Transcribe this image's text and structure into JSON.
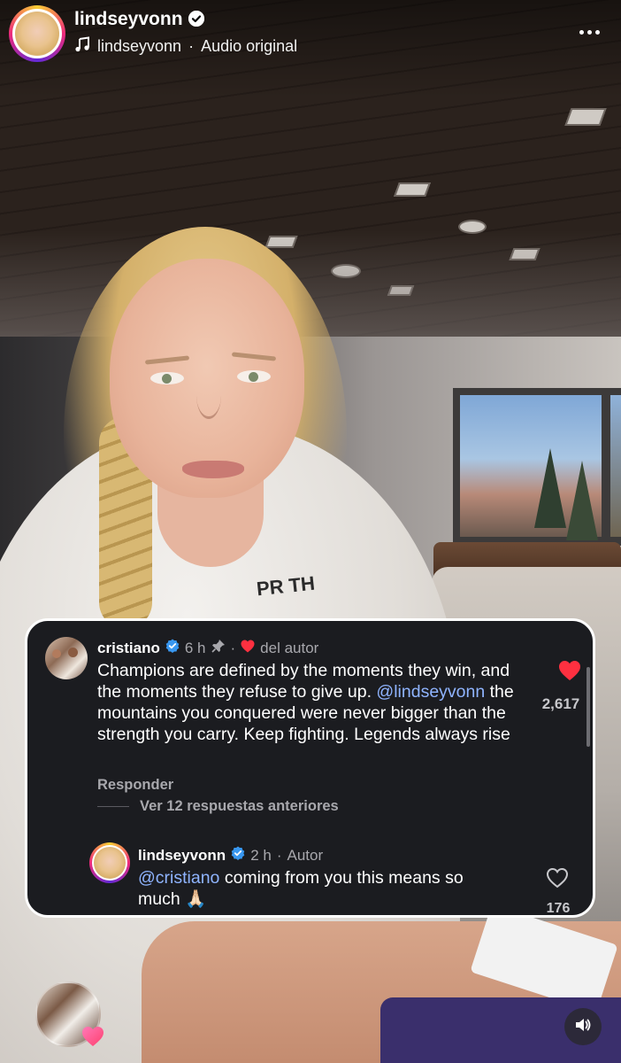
{
  "header": {
    "username": "lindseyvonn",
    "audio_user": "lindseyvonn",
    "audio_separator": "·",
    "audio_label": "Audio original"
  },
  "video": {
    "hoodie_print": "PR TH"
  },
  "comment": {
    "username": "cristiano",
    "time": "6 h",
    "separator": "·",
    "author_like_label": "del autor",
    "text_part1": "Champions are defined by the moments they win, and the moments they refuse to give up. ",
    "mention": "@lindseyvonn",
    "text_part2": " the mountains you conquered were never bigger than the strength you carry. Keep fighting. Legends always rise",
    "like_count": "2,617",
    "reply_label": "Responder",
    "view_replies_label": "Ver 12 respuestas anteriores",
    "liked": true
  },
  "reply": {
    "username": "lindseyvonn",
    "time": "2 h",
    "separator": "·",
    "author_badge": "Autor",
    "mention": "@cristiano",
    "text": " coming from you this means so much 🙏🏻",
    "like_count": "176",
    "liked": false
  },
  "colors": {
    "like_red": "#ff3040",
    "mention_blue": "#8fb4ff",
    "verified_blue": "#3897f0",
    "card_bg": "#1b1c20"
  },
  "icons": {
    "verified": "verified-badge-icon",
    "audio": "music-note-icon",
    "more": "more-options-icon",
    "pin": "pin-icon",
    "heart": "heart-icon",
    "sound": "speaker-icon"
  }
}
